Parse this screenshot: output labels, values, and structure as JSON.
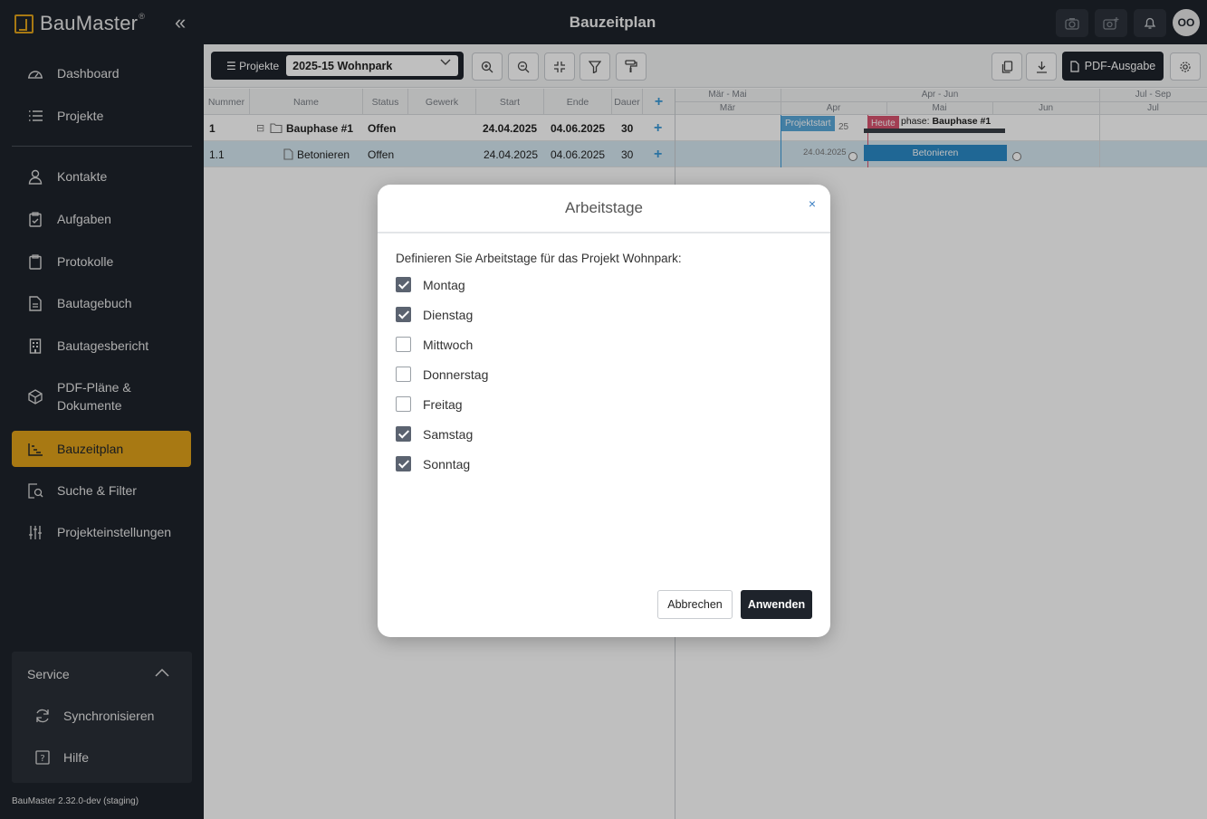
{
  "app": {
    "name": "BauMaster",
    "version": "BauMaster 2.32.0-dev (staging)",
    "avatar_initials": "OO"
  },
  "header": {
    "title": "Bauzeitplan"
  },
  "sidebar": {
    "items": [
      {
        "label": "Dashboard",
        "icon": "dashboard-icon"
      },
      {
        "label": "Projekte",
        "icon": "list-icon"
      },
      {
        "label": "Kontakte",
        "icon": "person-icon"
      },
      {
        "label": "Aufgaben",
        "icon": "clipboard-check-icon"
      },
      {
        "label": "Protokolle",
        "icon": "clipboard-icon"
      },
      {
        "label": "Bautagebuch",
        "icon": "document-icon"
      },
      {
        "label": "Bautagesbericht",
        "icon": "building-icon"
      },
      {
        "label": "PDF-Pläne & Dokumente",
        "label_line1": "PDF-Pläne &",
        "label_line2": "Dokumente",
        "icon": "cube-icon"
      },
      {
        "label": "Bauzeitplan",
        "icon": "gantt-icon",
        "active": true
      },
      {
        "label": "Suche & Filter",
        "icon": "search-document-icon"
      },
      {
        "label": "Projekteinstellungen",
        "icon": "sliders-icon"
      }
    ],
    "service": {
      "title": "Service",
      "items": [
        {
          "label": "Synchronisieren",
          "icon": "sync-icon"
        },
        {
          "label": "Hilfe",
          "icon": "help-icon"
        }
      ]
    }
  },
  "toolbar": {
    "project_label": "Projekte",
    "project_value": "2025-15 Wohnpark",
    "pdf_label": "PDF-Ausgabe"
  },
  "grid": {
    "columns": [
      "Nummer",
      "Name",
      "Status",
      "Gewerk",
      "Start",
      "Ende",
      "Dauer"
    ],
    "rows": [
      {
        "number": "1",
        "name": "Bauphase #1",
        "status": "Offen",
        "trade": "",
        "start": "24.04.2025",
        "end": "04.06.2025",
        "duration": "30"
      },
      {
        "number": "1.1",
        "name": "Betonieren",
        "status": "Offen",
        "trade": "",
        "start": "24.04.2025",
        "end": "04.06.2025",
        "duration": "30"
      }
    ]
  },
  "chart": {
    "quarters": [
      "Mär - Mai",
      "Apr - Jun",
      "Jul - Sep"
    ],
    "months": [
      "Mär",
      "Apr",
      "Mai",
      "Jun",
      "Jul"
    ],
    "project_start_label": "Projektstart",
    "project_start_partial": "25",
    "today_label": "Heute",
    "phase_label_prefix": "phase: ",
    "phase_label_bold": "Bauphase #1",
    "task_date": "24.04.2025",
    "task_label": "Betonieren"
  },
  "modal": {
    "title": "Arbeitstage",
    "close": "×",
    "description": "Definieren Sie Arbeitstage für das Projekt Wohnpark:",
    "days": [
      {
        "label": "Montag",
        "checked": true
      },
      {
        "label": "Dienstag",
        "checked": true
      },
      {
        "label": "Mittwoch",
        "checked": false
      },
      {
        "label": "Donnerstag",
        "checked": false
      },
      {
        "label": "Freitag",
        "checked": false
      },
      {
        "label": "Samstag",
        "checked": true
      },
      {
        "label": "Sonntag",
        "checked": true
      }
    ],
    "cancel_label": "Abbrechen",
    "apply_label": "Anwenden"
  },
  "colors": {
    "accent": "#e0a21a",
    "dark": "#1e232b",
    "bar": "#2a8ac7",
    "today": "#d9536f"
  }
}
